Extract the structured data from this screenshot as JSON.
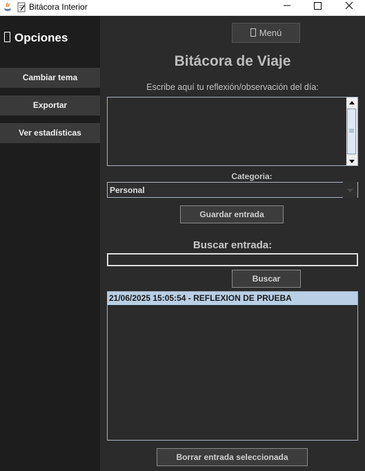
{
  "window": {
    "title": "Bitácora Interior",
    "controls": {
      "minimize": "minimize-icon",
      "maximize": "maximize-icon",
      "close": "close-icon"
    }
  },
  "sidebar": {
    "title": "Opciones",
    "title_icon": "missing-glyph-icon",
    "buttons": [
      {
        "label": "Cambiar tema"
      },
      {
        "label": "Exportar"
      },
      {
        "label": "Ver estadísticas"
      }
    ]
  },
  "main": {
    "menu_button": {
      "label": "Menú",
      "icon": "missing-glyph-icon"
    },
    "title": "Bitácora de Viaje",
    "prompt": "Escribe aquí tu reflexión/observación del día:",
    "reflection_text": "",
    "category": {
      "label": "Categoria:",
      "selected": "Personal"
    },
    "save_button": "Guardar entrada",
    "search": {
      "label": "Buscar entrada:",
      "value": "",
      "button": "Buscar"
    },
    "entries": [
      {
        "text": "21/06/2025 15:05:54 - REFLEXION DE PRUEBA",
        "selected": true
      }
    ],
    "delete_button": "Borrar entrada seleccionada"
  },
  "colors": {
    "background": "#2b2b2b",
    "sidebar": "#1d1d1d",
    "button": "#3c3c3c",
    "selection": "#b8cfe5",
    "border": "#a8b4c4"
  }
}
